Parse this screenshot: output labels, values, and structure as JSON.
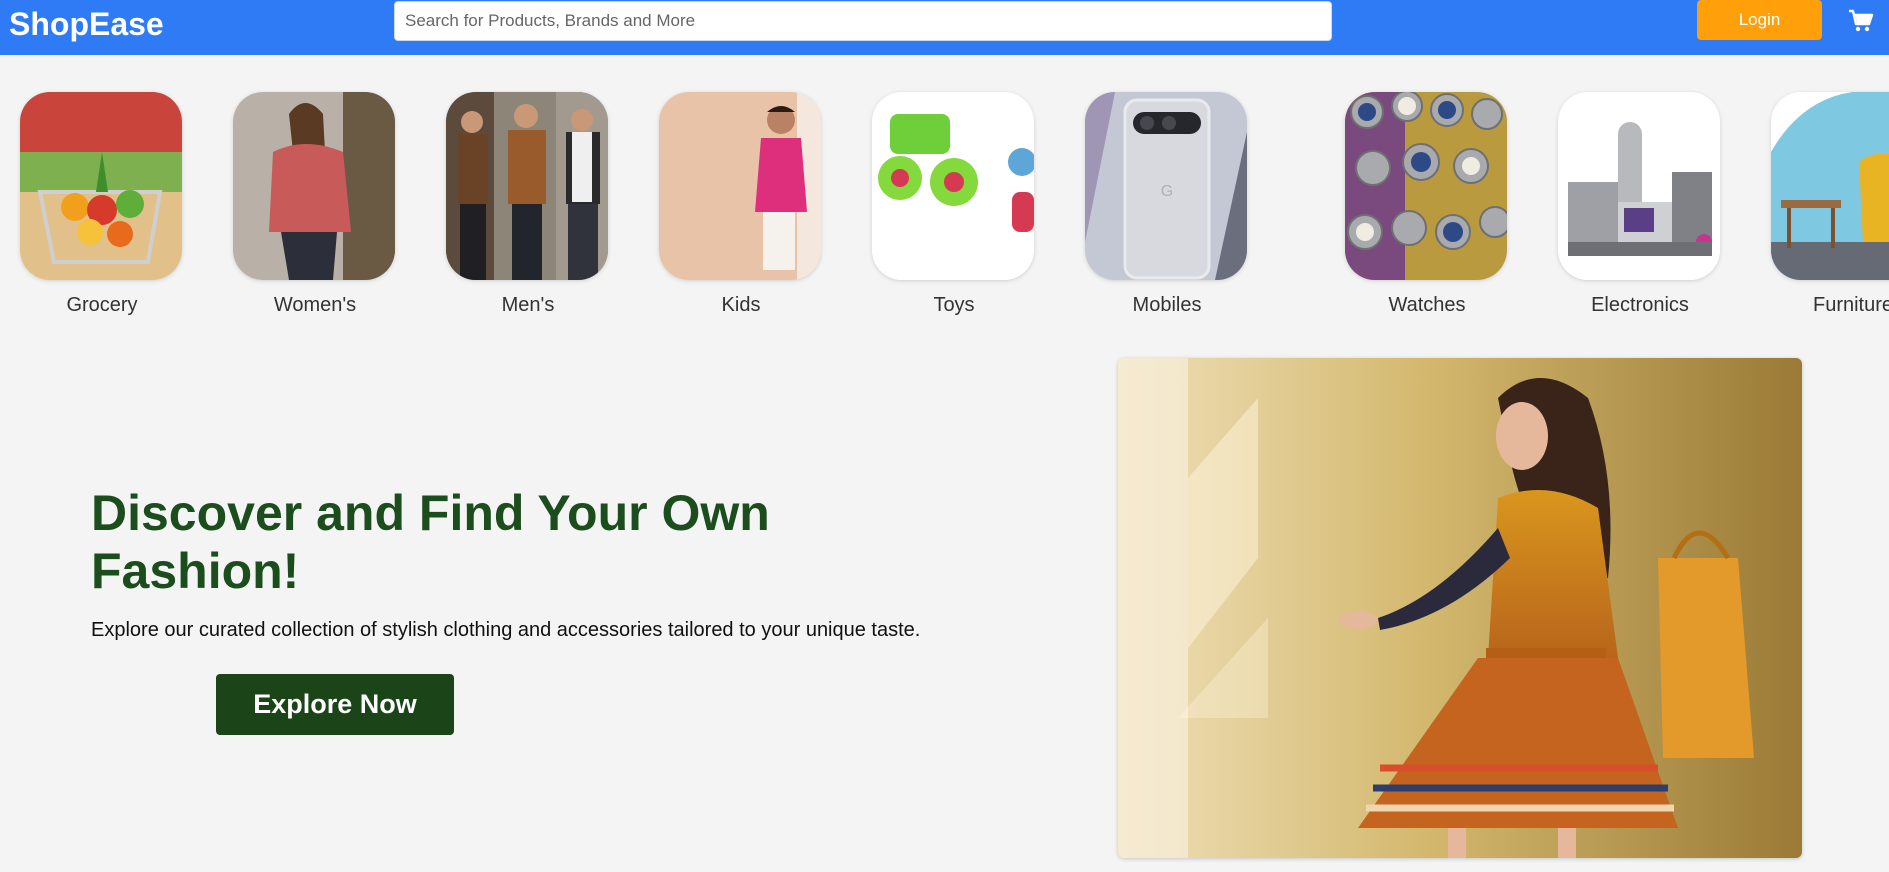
{
  "header": {
    "logo": "ShopEase",
    "search_placeholder": "Search for Products, Brands and More",
    "login_label": "Login",
    "cart_icon": "cart-icon"
  },
  "categories": [
    {
      "label": "Grocery"
    },
    {
      "label": "Women's"
    },
    {
      "label": "Men's"
    },
    {
      "label": "Kids"
    },
    {
      "label": "Toys"
    },
    {
      "label": "Mobiles"
    },
    {
      "label": "Watches"
    },
    {
      "label": "Electronics"
    },
    {
      "label": "Furniture"
    }
  ],
  "hero": {
    "title": "Discover and Find Your Own Fashion!",
    "subtitle": "Explore our curated collection of stylish clothing and accessories tailored to your unique taste.",
    "cta_label": "Explore Now"
  },
  "colors": {
    "header_bg": "#2f7bf5",
    "login_bg": "#ff9f0a",
    "title_green": "#1b4d1d",
    "cta_bg": "#1b4419"
  }
}
